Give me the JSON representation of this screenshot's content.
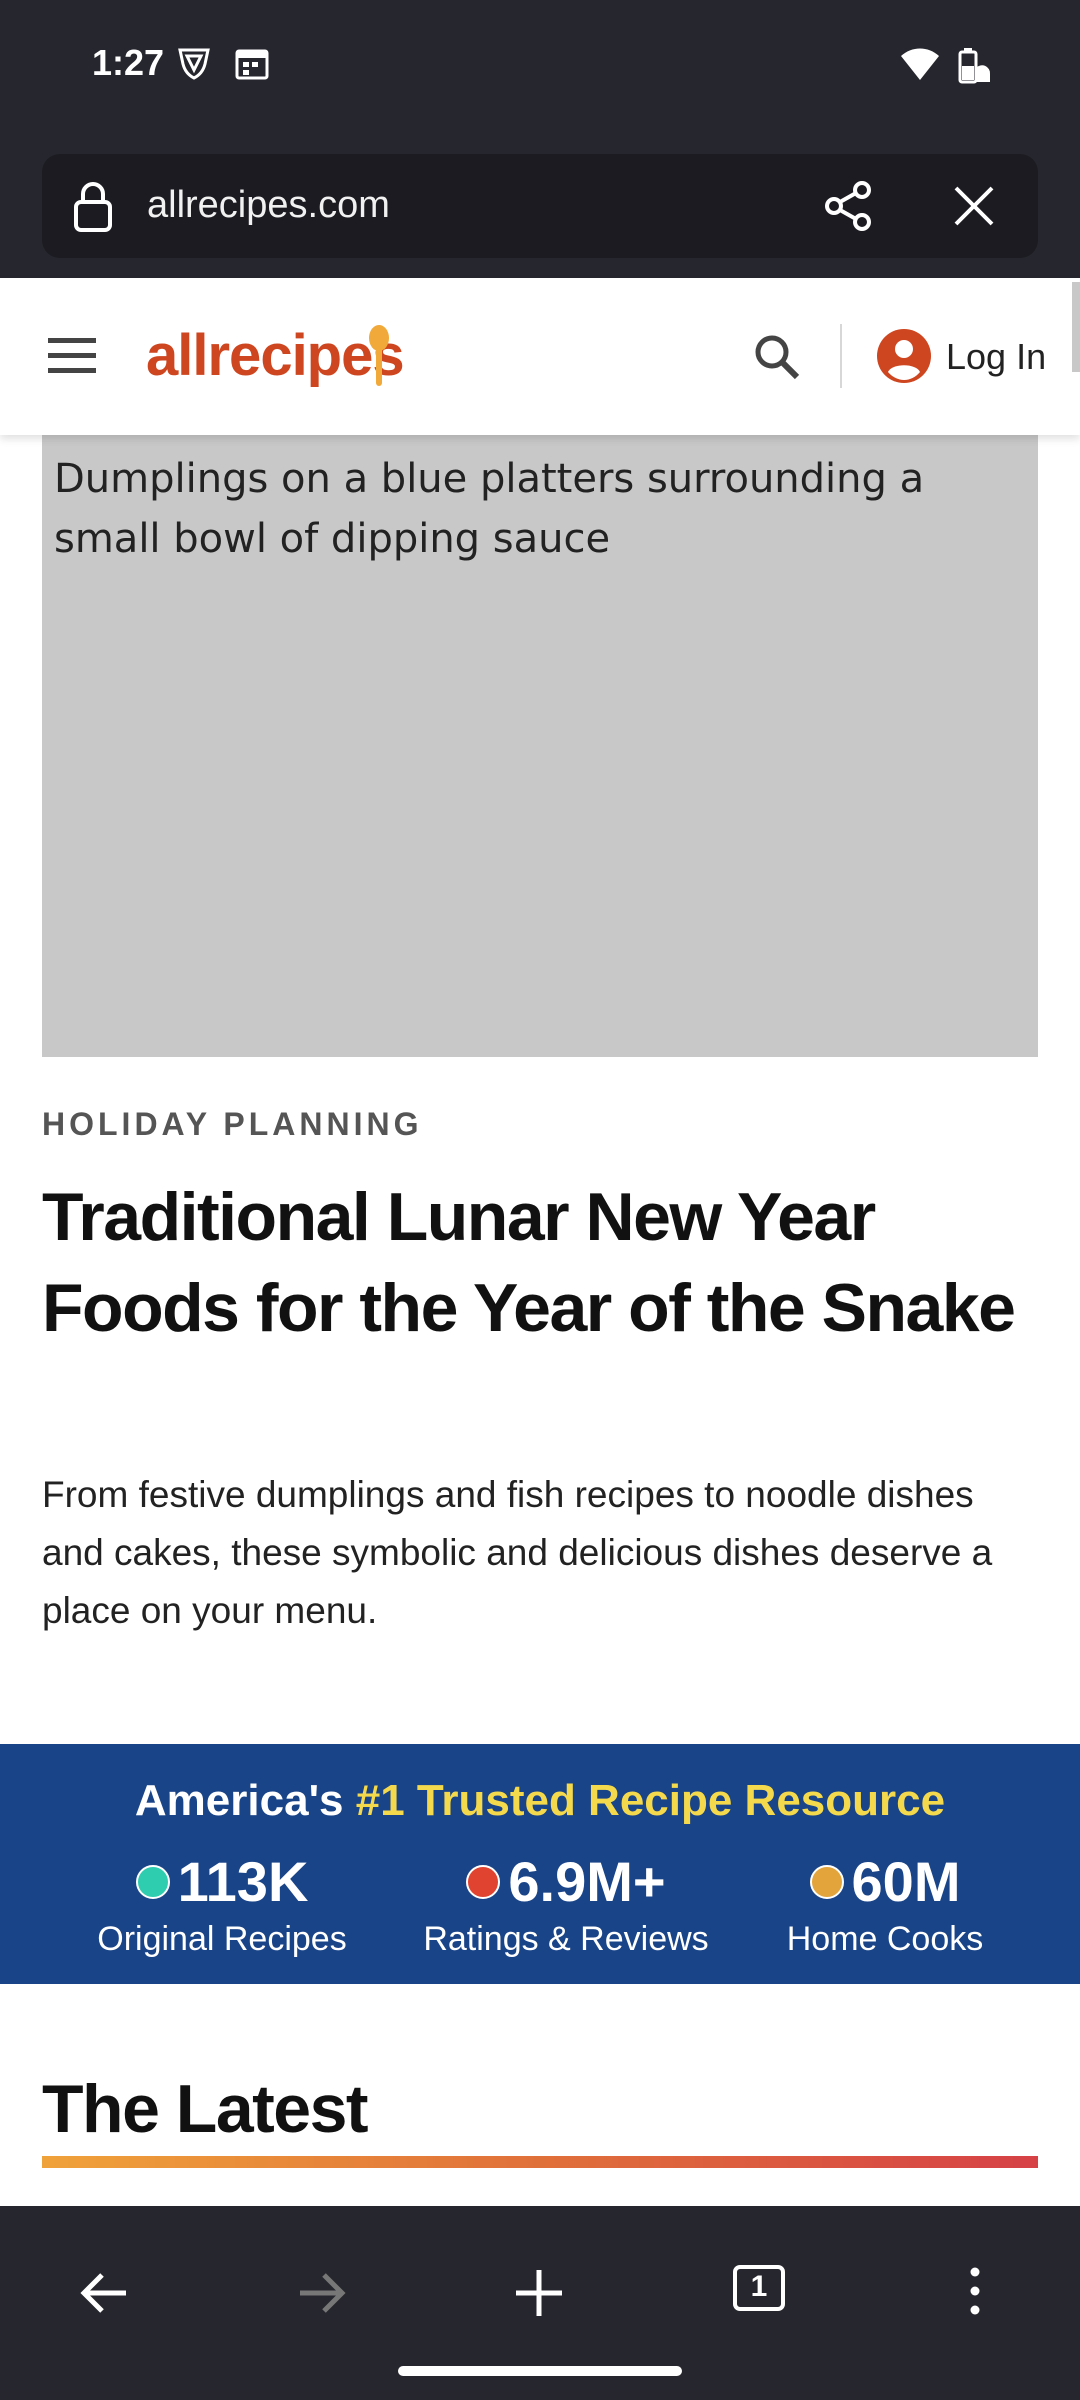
{
  "status_bar": {
    "time": "1:27"
  },
  "browser": {
    "url": "allrecipes.com"
  },
  "header": {
    "logo_text": "allrecipes",
    "login_label": "Log In"
  },
  "hero": {
    "alt_text": "Dumplings on a blue platters surrounding a small bowl of dipping sauce"
  },
  "article": {
    "kicker": "HOLIDAY PLANNING",
    "headline": "Traditional Lunar New Year Foods for the Year of the Snake",
    "subtext": "From festive dumplings and fish recipes to noodle dishes and cakes, these symbolic and delicious dishes deserve a place on your menu."
  },
  "banner": {
    "title_start": "America's ",
    "title_accent": "#1 Trusted Recipe Resource",
    "stats": [
      {
        "value": "113K",
        "label": "Original Recipes",
        "dot_color": "#2ecdb0"
      },
      {
        "value": "6.9M+",
        "label": "Ratings & Reviews",
        "dot_color": "#e0432f"
      },
      {
        "value": "60M",
        "label": "Home Cooks",
        "dot_color": "#e2a43b"
      }
    ]
  },
  "latest": {
    "title": "The Latest"
  },
  "bottom_nav": {
    "tab_count": "1"
  },
  "colors": {
    "brand": "#ce4620",
    "banner_bg": "#1a4488",
    "banner_accent": "#f5d94d",
    "chrome_bg": "#26262e"
  }
}
